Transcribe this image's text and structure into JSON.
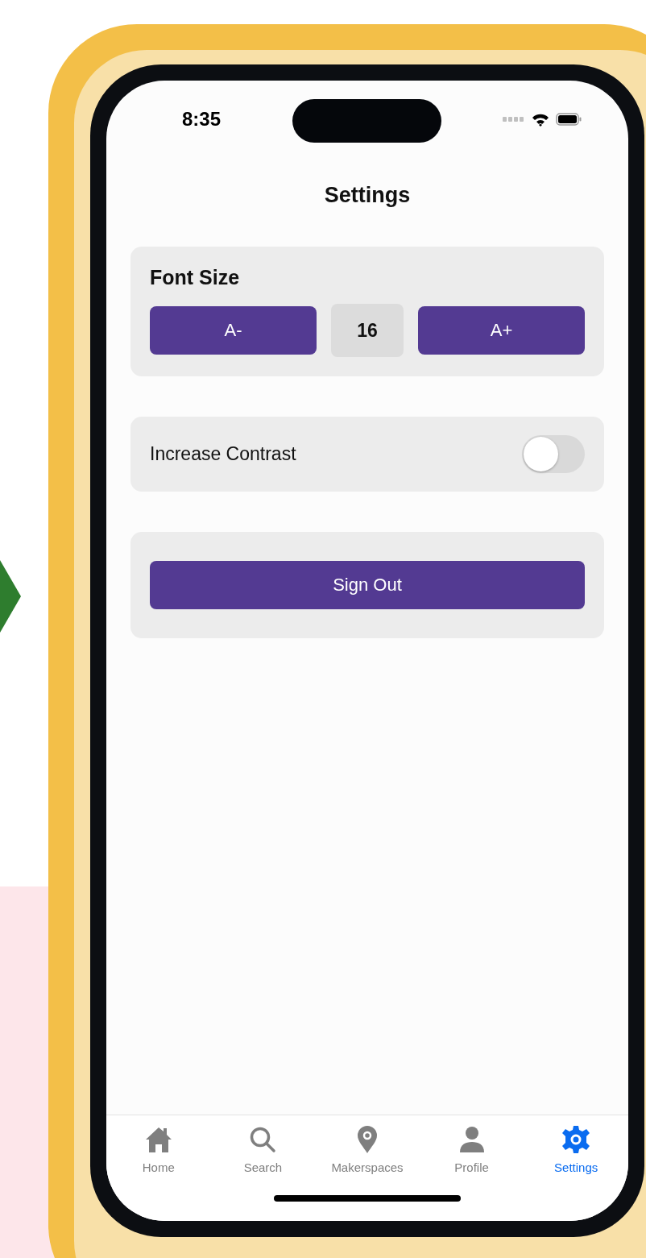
{
  "status_bar": {
    "time": "8:35"
  },
  "header": {
    "title": "Settings"
  },
  "font_size": {
    "label": "Font Size",
    "decrease": "A-",
    "value": "16",
    "increase": "A+"
  },
  "contrast": {
    "label": "Increase Contrast",
    "on": false
  },
  "sign_out": {
    "label": "Sign Out"
  },
  "tabs": [
    {
      "label": "Home",
      "kind": "home",
      "selected": false
    },
    {
      "label": "Search",
      "kind": "search",
      "selected": false
    },
    {
      "label": "Makerspaces",
      "kind": "pin",
      "selected": false
    },
    {
      "label": "Profile",
      "kind": "person",
      "selected": false
    },
    {
      "label": "Settings",
      "kind": "gear",
      "selected": true
    }
  ]
}
